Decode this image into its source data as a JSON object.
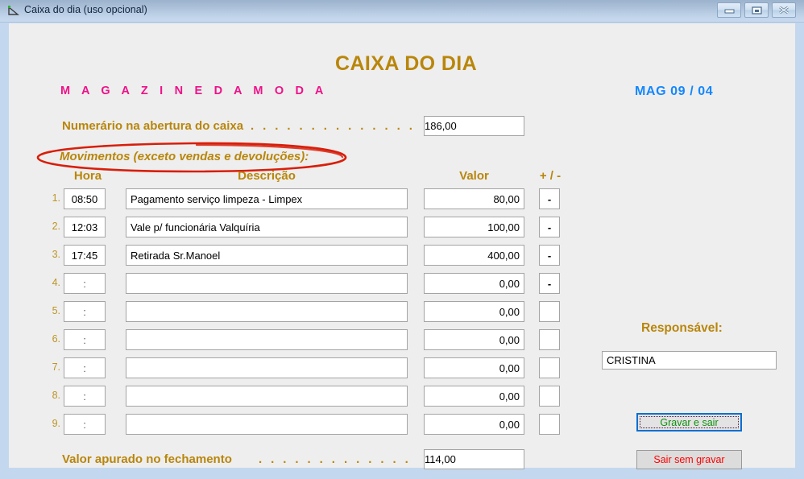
{
  "window": {
    "title": "Caixa do dia (uso opcional)",
    "icon": "ruler-triangle-icon",
    "controls": {
      "minimize": "minimize-icon",
      "maximize": "restore-icon",
      "close": "close-icon"
    }
  },
  "header": {
    "app_title": "CAIXA DO DIA",
    "store_name": "M A G A Z I N E   D A   M O D A",
    "session_tag": "MAG   09 / 04"
  },
  "opening": {
    "label": "Numerário na abertura do caixa",
    "leader": ". . . . . . . . . . . . . . . . . . . . .",
    "value": "186,00"
  },
  "movements": {
    "heading": "Movimentos (exceto vendas e devoluções):",
    "annotation": "red-ellipse-highlight",
    "columns": {
      "hora": "Hora",
      "descricao": "Descrição",
      "valor": "Valor",
      "sinal": "+ / -"
    },
    "rows": [
      {
        "num": "1.",
        "hora": "08:50",
        "descricao": "Pagamento serviço limpeza - Limpex",
        "valor": "80,00",
        "sinal": "-"
      },
      {
        "num": "2.",
        "hora": "12:03",
        "descricao": "Vale p/ funcionária Valquíria",
        "valor": "100,00",
        "sinal": "-"
      },
      {
        "num": "3.",
        "hora": "17:45",
        "descricao": "Retirada Sr.Manoel",
        "valor": "400,00",
        "sinal": "-"
      },
      {
        "num": "4.",
        "hora": ":",
        "descricao": "",
        "valor": "0,00",
        "sinal": "-"
      },
      {
        "num": "5.",
        "hora": ":",
        "descricao": "",
        "valor": "0,00",
        "sinal": ""
      },
      {
        "num": "6.",
        "hora": ":",
        "descricao": "",
        "valor": "0,00",
        "sinal": ""
      },
      {
        "num": "7.",
        "hora": ":",
        "descricao": "",
        "valor": "0,00",
        "sinal": ""
      },
      {
        "num": "8.",
        "hora": ":",
        "descricao": "",
        "valor": "0,00",
        "sinal": ""
      },
      {
        "num": "9.",
        "hora": ":",
        "descricao": "",
        "valor": "0,00",
        "sinal": ""
      }
    ]
  },
  "closing": {
    "label": "Valor apurado no fechamento",
    "leader": ". . . . . . . . . . . . . . . . . . . .",
    "value": "114,00"
  },
  "responsible": {
    "label": "Responsável:",
    "value": "CRISTINA"
  },
  "actions": {
    "save_label": "Gravar e sair",
    "discard_label": "Sair sem gravar"
  },
  "colors": {
    "gold": "#b8860b",
    "pink": "#ee1289",
    "blue": "#1287ff",
    "green": "#0e8f0e",
    "red": "#ff0000",
    "annotation_red": "#d81e0a",
    "client_bg": "#efeeee",
    "frame_blue": "#c3d8ef"
  }
}
